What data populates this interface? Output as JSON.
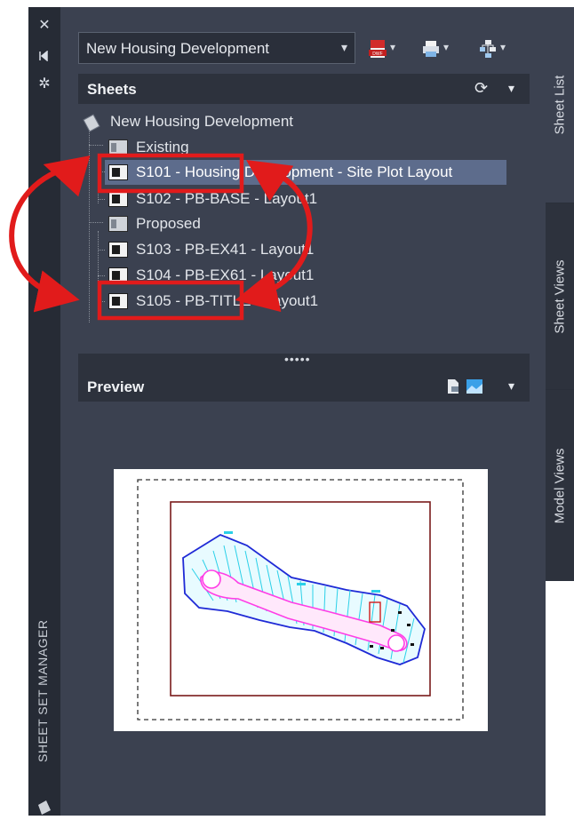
{
  "left_strip": {
    "buttons": [
      {
        "name": "close-icon",
        "glyph": "✕"
      },
      {
        "name": "auto-hide-icon",
        "glyph": "⧗"
      },
      {
        "name": "properties-icon",
        "glyph": "✲"
      }
    ],
    "title": "SHEET SET MANAGER"
  },
  "toolbar": {
    "sheet_set_value": "New Housing Development",
    "dropdown_chevron": "▾",
    "buttons": [
      {
        "name": "publish-dwf-icon",
        "color": "#d22b2b"
      },
      {
        "name": "plot-icon",
        "color": "#7fb4e6"
      },
      {
        "name": "sheet-selections-icon",
        "color": "#9fc8ee"
      }
    ],
    "caret": "▾"
  },
  "sheets_section": {
    "title": "Sheets",
    "refresh_glyph": "⟳",
    "menu_glyph": "▾"
  },
  "tree": {
    "root": "New Housing Development",
    "items": [
      {
        "label": "Existing",
        "type": "subset"
      },
      {
        "label": "S101 - Housing Development - Site Plot Layout",
        "type": "sheet",
        "selected": true
      },
      {
        "label": "S102 - PB-BASE - Layout1",
        "type": "sheet"
      },
      {
        "label": "Proposed",
        "type": "subset"
      },
      {
        "label": "S103 - PB-EX41 - Layout1",
        "type": "sheet"
      },
      {
        "label": "S104 - PB-EX61 - Layout1",
        "type": "sheet"
      },
      {
        "label": "S105 - PB-TITLE - Layout1",
        "type": "sheet"
      }
    ]
  },
  "splitter": {
    "grip": "•••••"
  },
  "preview_section": {
    "title": "Preview",
    "menu_glyph": "▾"
  },
  "tabs": [
    {
      "label": "Sheet List",
      "active": true
    },
    {
      "label": "Sheet Views",
      "active": false
    },
    {
      "label": "Model Views",
      "active": false
    }
  ],
  "colors": {
    "panel": "#3b4150",
    "header": "#2d323d",
    "selection": "#5d6c8c",
    "annotation": "#e11b1b",
    "drawing_lines": "#2ad0e8",
    "drawing_path": "#ff3de6",
    "drawing_border": "#1f2ad6"
  }
}
